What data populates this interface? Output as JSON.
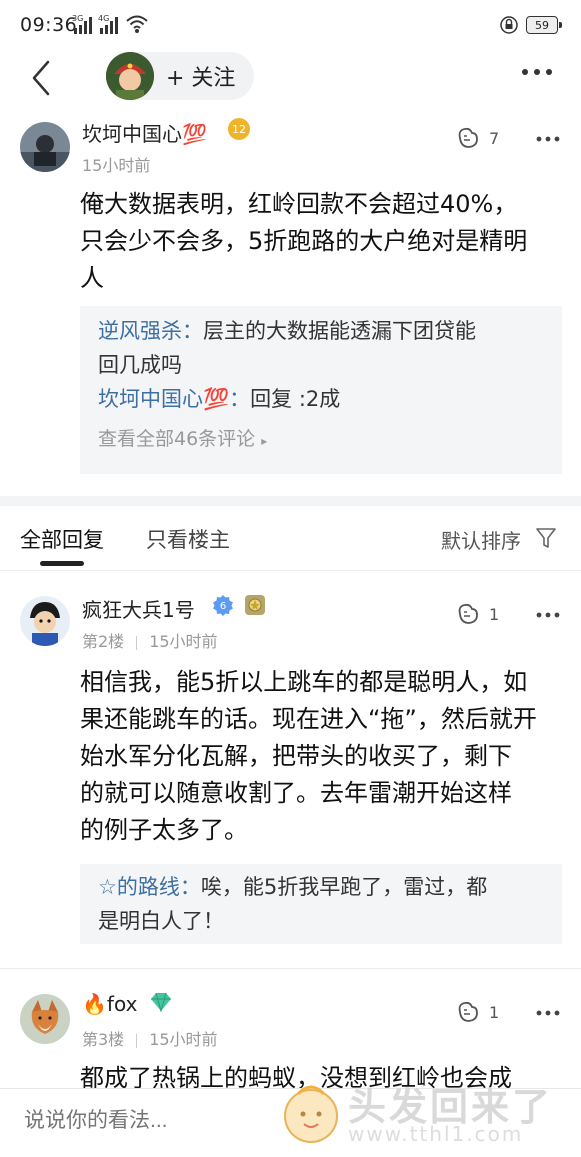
{
  "status_bar": {
    "time": "09:36",
    "signal1": "3G",
    "signal2": "4G",
    "battery": "59"
  },
  "nav": {
    "follow_label": "+ 关注"
  },
  "first_post": {
    "user": "坎坷中国心",
    "user_emoji": "💯",
    "level": "12",
    "time": "15小时前",
    "likes": "7",
    "content": [
      "俺大数据表明，红岭回款不会超过40%，",
      "只会少不会多，5折跑路的大户绝对是精明",
      "人"
    ],
    "replies": [
      {
        "user": "逆风强杀：",
        "text_line1": "层主的大数据能透漏下团贷能",
        "text_line2": "回几成吗"
      },
      {
        "user": "坎坷中国心💯：",
        "text": "回复  :2成"
      }
    ],
    "view_all": "查看全部46条评论"
  },
  "tabs": {
    "all": "全部回复",
    "op_only": "只看楼主",
    "sort": "默认排序"
  },
  "posts": [
    {
      "user": "疯狂大兵1号",
      "level": "6",
      "floor": "第2楼",
      "time": "15小时前",
      "likes": "1",
      "content": [
        "相信我，能5折以上跳车的都是聪明人，如",
        "果还能跳车的话。现在进入“拖”，然后就开",
        "始水军分化瓦解，把带头的收买了，剩下",
        "的就可以随意收割了。去年雷潮开始这样",
        "的例子太多了。"
      ],
      "reply": {
        "user": "☆的路线：",
        "text_line1": "唉，能5折我早跑了，雷过，都",
        "text_line2": "是明白人了！"
      }
    },
    {
      "user": "fox",
      "user_prefix": "🔥",
      "floor": "第3楼",
      "time": "15小时前",
      "likes": "1",
      "content": [
        "都成了热锅上的蚂蚁，没想到红岭也会成"
      ]
    }
  ],
  "bottom": {
    "placeholder": "说说你的看法..."
  },
  "watermark": {
    "text": "头发回来了",
    "url": "www.tthl1.com"
  },
  "colors": {
    "link": "#3e6fa3",
    "reply_bg": "#f4f5f7",
    "level_badge": "#f0b429",
    "v_badge": "#5b9cf2"
  },
  "icons": [
    "back-icon",
    "more-icon",
    "like-icon",
    "filter-icon",
    "wifi-icon",
    "lock-icon",
    "verified-icon",
    "medal-icon",
    "diamond-icon"
  ]
}
